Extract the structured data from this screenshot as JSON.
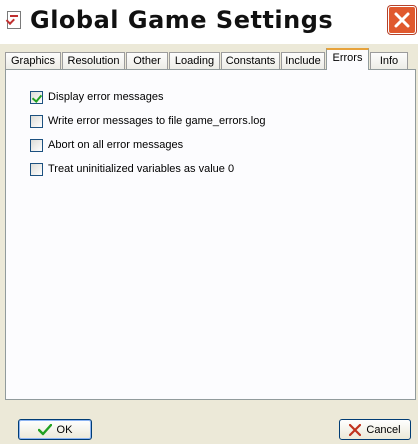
{
  "window": {
    "title": "Global Game Settings"
  },
  "tabs": [
    {
      "label": "Graphics",
      "active": false
    },
    {
      "label": "Resolution",
      "active": false
    },
    {
      "label": "Other",
      "active": false
    },
    {
      "label": "Loading",
      "active": false
    },
    {
      "label": "Constants",
      "active": false
    },
    {
      "label": "Include",
      "active": false
    },
    {
      "label": "Errors",
      "active": true
    },
    {
      "label": "Info",
      "active": false
    }
  ],
  "options": [
    {
      "label": "Display error messages",
      "checked": true
    },
    {
      "label": "Write error messages to file game_errors.log",
      "checked": false
    },
    {
      "label": "Abort on all error messages",
      "checked": false
    },
    {
      "label": "Treat uninitialized variables as value 0",
      "checked": false
    }
  ],
  "buttons": {
    "ok_label": "OK",
    "cancel_label": "Cancel"
  },
  "icons": {
    "title": "settings-document-icon",
    "close": "close-icon",
    "ok": "checkmark-icon",
    "cancel": "x-icon"
  },
  "colors": {
    "close_button": "#e0592e",
    "active_tab_accent": "#e7a23a",
    "checkmark": "#21a121",
    "cancel_x": "#c1331f",
    "background": "#ece9d8"
  }
}
